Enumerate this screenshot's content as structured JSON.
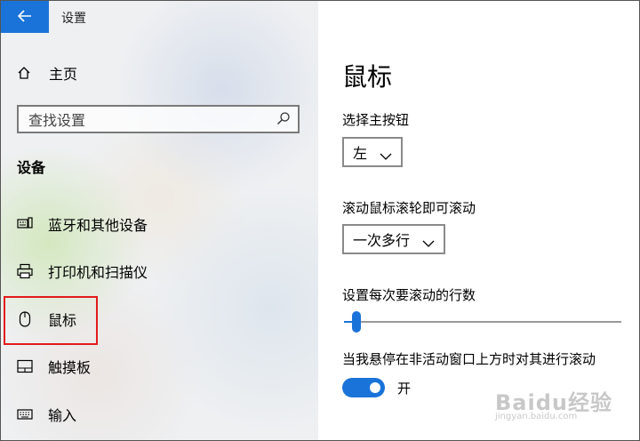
{
  "window": {
    "title": "设置"
  },
  "sidebar": {
    "home_label": "主页",
    "search_placeholder": "查找设置",
    "section_title": "设备",
    "items": [
      {
        "label": "蓝牙和其他设备",
        "icon": "bluetooth-devices-icon"
      },
      {
        "label": "打印机和扫描仪",
        "icon": "printer-icon"
      },
      {
        "label": "鼠标",
        "icon": "mouse-icon",
        "selected": true
      },
      {
        "label": "触摸板",
        "icon": "touchpad-icon"
      },
      {
        "label": "输入",
        "icon": "keyboard-icon"
      }
    ]
  },
  "main": {
    "title": "鼠标",
    "primary_button": {
      "label": "选择主按钮",
      "value": "左"
    },
    "scroll_wheel": {
      "label": "滚动鼠标滚轮即可滚动",
      "value": "一次多行"
    },
    "lines_to_scroll": {
      "label": "设置每次要滚动的行数",
      "fraction": 0.03
    },
    "inactive_scroll": {
      "label": "当我悬停在非活动窗口上方时对其进行滚动",
      "state": "开",
      "on": true
    }
  },
  "watermark": {
    "logo_text": "Baidu经验",
    "url_text": "jingyan.baidu.com"
  },
  "colors": {
    "accent": "#1a73d8",
    "highlight_box": "#e21b1b"
  }
}
